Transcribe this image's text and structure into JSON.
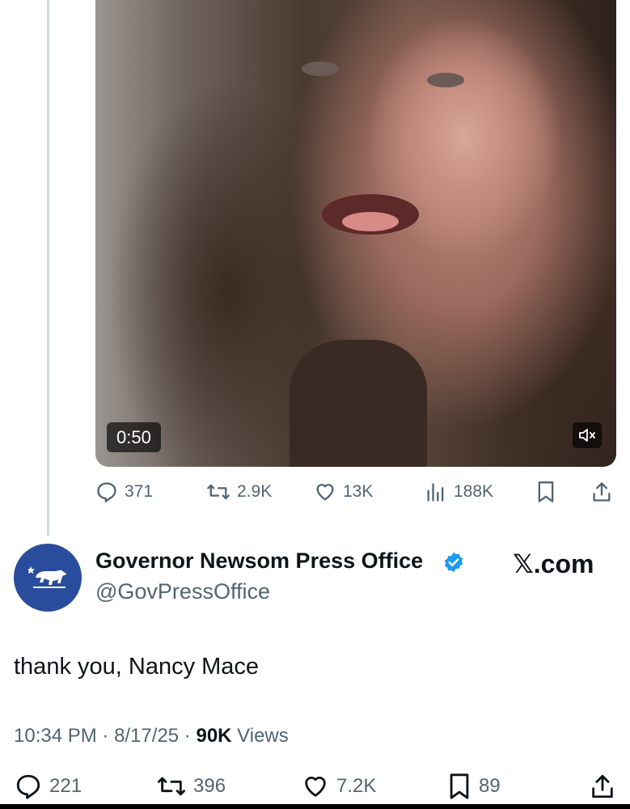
{
  "quoted_post": {
    "video": {
      "duration": "0:50",
      "mute_icon": "speaker-muted-icon"
    },
    "actions": {
      "replies": "371",
      "reposts": "2.9K",
      "likes": "13K",
      "views": "188K"
    }
  },
  "post": {
    "author": {
      "name": "Governor Newsom Press Office",
      "handle": "@GovPressOffice",
      "verified": true,
      "avatar_icon": "california-bear-icon",
      "avatar_color": "#2a4c9c"
    },
    "site": "𝕏.com",
    "text": "thank you, Nancy Mace",
    "time": "10:34 PM",
    "date": "8/17/25",
    "views_count": "90K",
    "views_label": "Views",
    "actions": {
      "replies": "221",
      "reposts": "396",
      "likes": "7.2K",
      "bookmarks": "89"
    }
  },
  "colors": {
    "muted_text": "#536471",
    "verified_blue": "#1d9bf0",
    "thread_line": "#cfd9de"
  }
}
